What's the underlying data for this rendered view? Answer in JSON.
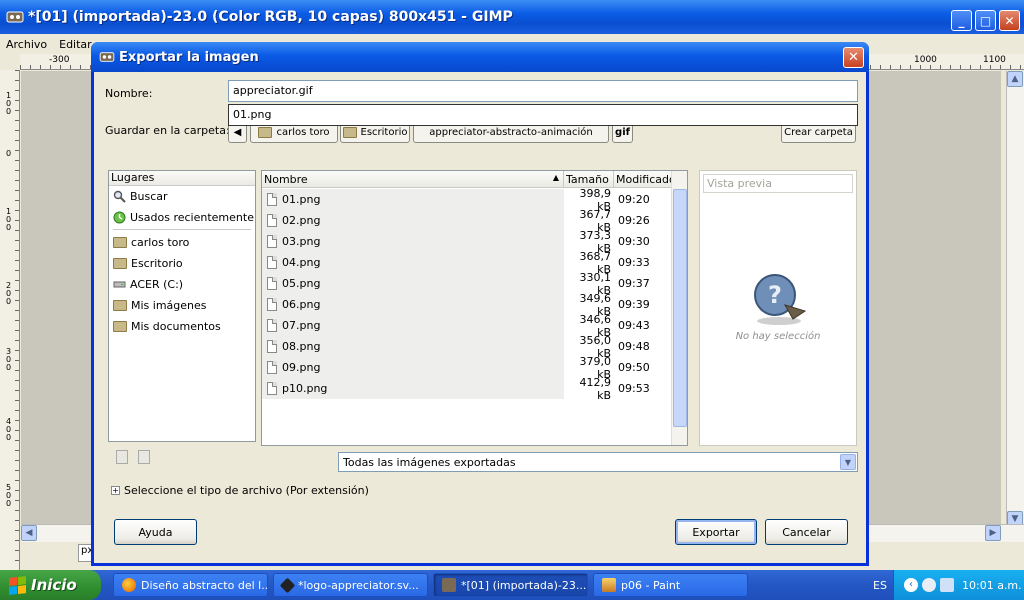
{
  "gimp": {
    "title": "*[01] (importada)-23.0 (Color RGB, 10 capas) 800x451 - GIMP",
    "menu": [
      "Archivo",
      "Editar"
    ],
    "ruler_top_labels": [
      {
        "label": "-300"
      },
      {
        "label": "1000"
      },
      {
        "label": "1100"
      }
    ],
    "ruler_left_labels": [
      "100",
      "0",
      "100",
      "200",
      "300",
      "400",
      "500"
    ],
    "unit": "px",
    "colors": {
      "titlebar": "#0a5ae6",
      "canvas": "#c9c6bc"
    }
  },
  "dialog": {
    "title": "Exportar la imagen",
    "name_label": "Nombre:",
    "name_value": "appreciator.gif",
    "autocomplete": "01.png",
    "folder_label": "Guardar en la carpeta:",
    "path": [
      "carlos toro",
      "Escritorio",
      "appreciator-abstracto-animación",
      "gif"
    ],
    "create_folder": "Crear carpeta",
    "places_header": "Lugares",
    "places": [
      {
        "label": "Buscar",
        "icon": "search-icon"
      },
      {
        "label": "Usados recientemente",
        "icon": "recent-icon"
      },
      {
        "label": "carlos toro",
        "icon": "folder-icon"
      },
      {
        "label": "Escritorio",
        "icon": "folder-icon"
      },
      {
        "label": "ACER (C:)",
        "icon": "drive-icon"
      },
      {
        "label": "Mis imágenes",
        "icon": "folder-icon"
      },
      {
        "label": "Mis documentos",
        "icon": "folder-icon"
      }
    ],
    "columns": {
      "name": "Nombre",
      "size": "Tamaño",
      "modified": "Modificado"
    },
    "files": [
      {
        "name": "01.png",
        "size": "398,9 kB",
        "modified": "09:20"
      },
      {
        "name": "02.png",
        "size": "367,7 kB",
        "modified": "09:26"
      },
      {
        "name": "03.png",
        "size": "373,3 kB",
        "modified": "09:30"
      },
      {
        "name": "04.png",
        "size": "368,7 kB",
        "modified": "09:33"
      },
      {
        "name": "05.png",
        "size": "330,1 kB",
        "modified": "09:37"
      },
      {
        "name": "06.png",
        "size": "349,6 kB",
        "modified": "09:39"
      },
      {
        "name": "07.png",
        "size": "346,6 kB",
        "modified": "09:43"
      },
      {
        "name": "08.png",
        "size": "356,0 kB",
        "modified": "09:48"
      },
      {
        "name": "09.png",
        "size": "379,0 kB",
        "modified": "09:50"
      },
      {
        "name": "p10.png",
        "size": "412,9 kB",
        "modified": "09:53"
      }
    ],
    "preview_header": "Vista previa",
    "preview_empty": "No hay selección",
    "filter": "Todas las imágenes exportadas",
    "filetype_expander": "Seleccione el tipo de archivo (Por extensión)",
    "help": "Ayuda",
    "export": "Exportar",
    "cancel": "Cancelar"
  },
  "taskbar": {
    "start": "Inicio",
    "items": [
      {
        "label": "Diseño abstracto del l...",
        "icon": "firefox-icon"
      },
      {
        "label": "*logo-appreciator.sv...",
        "icon": "inkscape-icon"
      },
      {
        "label": "*[01] (importada)-23...",
        "icon": "gimp-icon"
      },
      {
        "label": "p06 - Paint",
        "icon": "paint-icon"
      }
    ],
    "lang": "ES",
    "clock": "10:01 a.m."
  }
}
